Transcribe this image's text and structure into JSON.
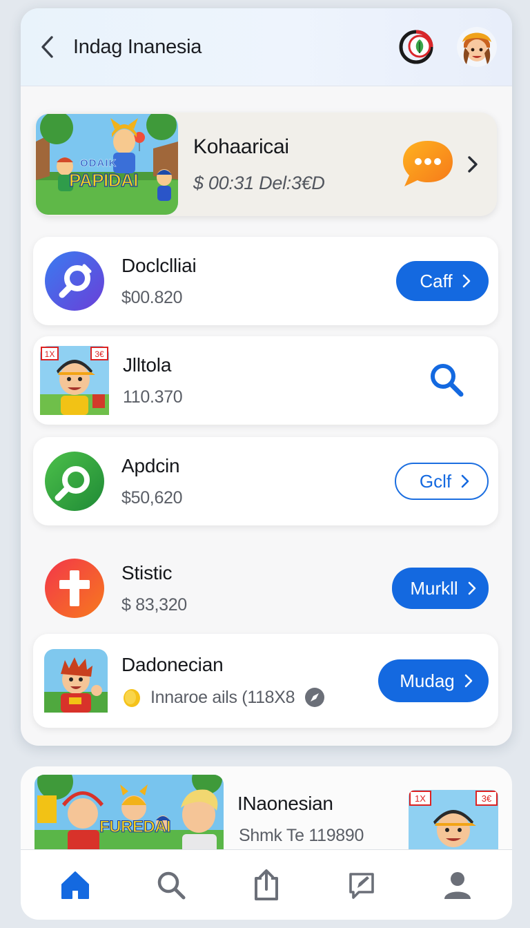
{
  "header": {
    "title": "Indag Inanesia",
    "back_icon": "chevron-left-icon",
    "badge_icon": "leaf-badge-icon",
    "avatar_icon": "user-avatar"
  },
  "featured": {
    "name": "Kohaaricai",
    "price": "$ 00:31 Del:3€D",
    "image_caption": "PAPIDAI",
    "image_caption_top": "ODAIK",
    "chat_icon": "chat-bubble-icon",
    "accent": "#f7931e"
  },
  "items": [
    {
      "name": "Doclclliai",
      "price": "$00.820",
      "icon": "search-circle-icon",
      "action": "Caff",
      "button_style": "filled"
    },
    {
      "name": "Jlltola",
      "price": "110.370",
      "icon": "character-app-icon",
      "action": "",
      "action_icon": "search-icon",
      "button_style": "icon"
    },
    {
      "name": "Apdcin",
      "price": "$50,620",
      "icon": "green-search-icon",
      "action": "Gclf",
      "button_style": "outline"
    },
    {
      "name": "Stistic",
      "price": "$ 83,320",
      "icon": "cross-app-icon",
      "action": "Murkll",
      "button_style": "filled"
    },
    {
      "name": "Dadonecian",
      "price": "Innaroe ails (118X8",
      "icon": "hero-app-icon",
      "action": "Mudag",
      "button_style": "filled"
    }
  ],
  "secondary": {
    "name": "INaonesian",
    "subtitle": "Shmk Te 119890",
    "image_caption": "FUREDAI"
  },
  "nav": [
    {
      "name": "home",
      "icon": "home-icon",
      "active": true
    },
    {
      "name": "search",
      "icon": "search-icon",
      "active": false
    },
    {
      "name": "share",
      "icon": "share-icon",
      "active": false
    },
    {
      "name": "compose",
      "icon": "edit-icon",
      "active": false
    },
    {
      "name": "profile",
      "icon": "person-icon",
      "active": false
    }
  ],
  "colors": {
    "primary": "#1469e0",
    "background": "#e3e8ee"
  }
}
